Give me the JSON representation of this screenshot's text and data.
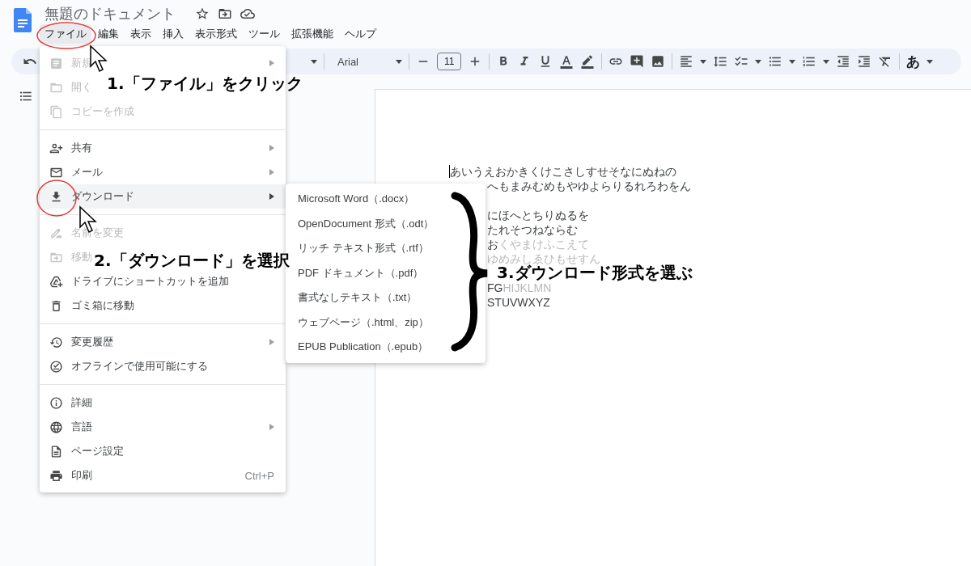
{
  "document": {
    "title": "無題のドキュメント"
  },
  "menubar": [
    {
      "label": "ファイル",
      "selected": true
    },
    {
      "label": "編集",
      "selected": false
    },
    {
      "label": "表示",
      "selected": false
    },
    {
      "label": "挿入",
      "selected": false
    },
    {
      "label": "表示形式",
      "selected": false
    },
    {
      "label": "ツール",
      "selected": false
    },
    {
      "label": "拡張機能",
      "selected": false
    },
    {
      "label": "ヘルプ",
      "selected": false
    }
  ],
  "toolbar": {
    "font": "Arial",
    "font_size": "11",
    "input_method": "あ"
  },
  "file_menu": [
    [
      {
        "label": "新規",
        "submenu": true,
        "disabled": true,
        "selected": false
      },
      {
        "label": "開く",
        "submenu": false,
        "disabled": true,
        "selected": false
      },
      {
        "label": "コピーを作成",
        "submenu": false,
        "disabled": true,
        "selected": false
      }
    ],
    [
      {
        "label": "共有",
        "submenu": true,
        "disabled": false,
        "selected": false
      },
      {
        "label": "メール",
        "submenu": true,
        "disabled": false,
        "selected": false
      },
      {
        "label": "ダウンロード",
        "submenu": true,
        "disabled": false,
        "selected": true
      }
    ],
    [
      {
        "label": "名前を変更",
        "submenu": false,
        "disabled": true,
        "selected": false
      },
      {
        "label": "移動",
        "submenu": false,
        "disabled": true,
        "selected": false
      },
      {
        "label": "ドライブにショートカットを追加",
        "submenu": false,
        "disabled": false,
        "selected": false
      },
      {
        "label": "ゴミ箱に移動",
        "submenu": false,
        "disabled": false,
        "selected": false
      }
    ],
    [
      {
        "label": "変更履歴",
        "submenu": true,
        "disabled": false,
        "selected": false
      },
      {
        "label": "オフラインで使用可能にする",
        "submenu": false,
        "disabled": false,
        "selected": false
      }
    ],
    [
      {
        "label": "詳細",
        "submenu": false,
        "disabled": false,
        "selected": false
      },
      {
        "label": "言語",
        "submenu": true,
        "disabled": false,
        "selected": false
      },
      {
        "label": "ページ設定",
        "submenu": false,
        "disabled": false,
        "selected": false
      },
      {
        "label": "印刷",
        "shortcut": "Ctrl+P",
        "submenu": false,
        "disabled": false,
        "selected": false
      }
    ]
  ],
  "download_submenu": [
    "Microsoft Word（.docx）",
    "OpenDocument 形式（.odt）",
    "リッチ テキスト形式（.rtf）",
    "PDF ドキュメント（.pdf）",
    "書式なしテキスト（.txt）",
    "ウェブページ（.html、zip）",
    "EPUB Publication（.epub）"
  ],
  "document_lines": [
    {
      "covered": false,
      "gap_before": false,
      "segments": [
        {
          "text": "あいうえおかきくけこさしすせそなにぬねの",
          "faded": false
        }
      ]
    },
    {
      "covered": true,
      "gap_before": false,
      "segments": [
        {
          "text": "へもまみむめもやゆよらりるれろわをん",
          "faded": false
        }
      ]
    },
    {
      "covered": true,
      "gap_before": true,
      "segments": [
        {
          "text": "にほへとちりぬるを",
          "faded": false
        }
      ]
    },
    {
      "covered": true,
      "gap_before": false,
      "segments": [
        {
          "text": "たれそつねならむ",
          "faded": false
        }
      ]
    },
    {
      "covered": true,
      "gap_before": false,
      "segments": [
        {
          "text": "お",
          "faded": false
        },
        {
          "text": "くやまけふこえて",
          "faded": true
        }
      ]
    },
    {
      "covered": true,
      "gap_before": false,
      "segments": [
        {
          "text": "ゆめみしゑひもせすん",
          "faded": true
        }
      ]
    },
    {
      "covered": true,
      "gap_before": true,
      "segments": [
        {
          "text": "FG",
          "faded": false
        },
        {
          "text": "HIJKLMN",
          "faded": true
        }
      ]
    },
    {
      "covered": true,
      "gap_before": false,
      "segments": [
        {
          "text": "STUVWXYZ",
          "faded": false
        }
      ]
    }
  ],
  "annotations": [
    {
      "kind": "step",
      "text": "1.「ファイル」をクリック"
    },
    {
      "kind": "step",
      "text": "2.「ダウンロード」を選択"
    },
    {
      "kind": "step",
      "text": "3.ダウンロード形式を選ぶ"
    }
  ]
}
